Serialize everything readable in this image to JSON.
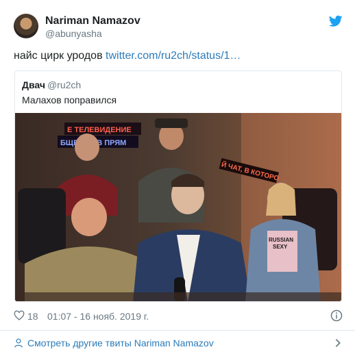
{
  "author": {
    "name": "Nariman Namazov",
    "handle": "@abunyasha"
  },
  "tweet": {
    "text": "найс цирк уродов ",
    "link": "twitter.com/ru2ch/status/1…"
  },
  "quoted": {
    "name": "Двач",
    "handle": "@ru2ch",
    "text": "Малахов поправился",
    "photo_signs": [
      "Е ТЕЛЕВИДЕНИЕ",
      "БЩЕНИЯ В ПРЯМ",
      "Й ЧАТ, В КОТОРО",
      "RUSSIAN",
      "SEXY"
    ]
  },
  "meta": {
    "likes": "18",
    "timestamp": "01:07 - 16 нояб. 2019 г."
  },
  "footer": {
    "more_tweets": "Смотреть другие твиты Nariman Namazov"
  },
  "icons": {
    "bird": "twitter-bird-icon",
    "heart": "heart-icon",
    "info": "info-icon",
    "person": "person-icon",
    "chevron": "chevron-right-icon"
  },
  "colors": {
    "link": "#2b7bb9",
    "secondary": "#697882",
    "border": "#e1e8ed",
    "brand": "#1da1f2"
  }
}
